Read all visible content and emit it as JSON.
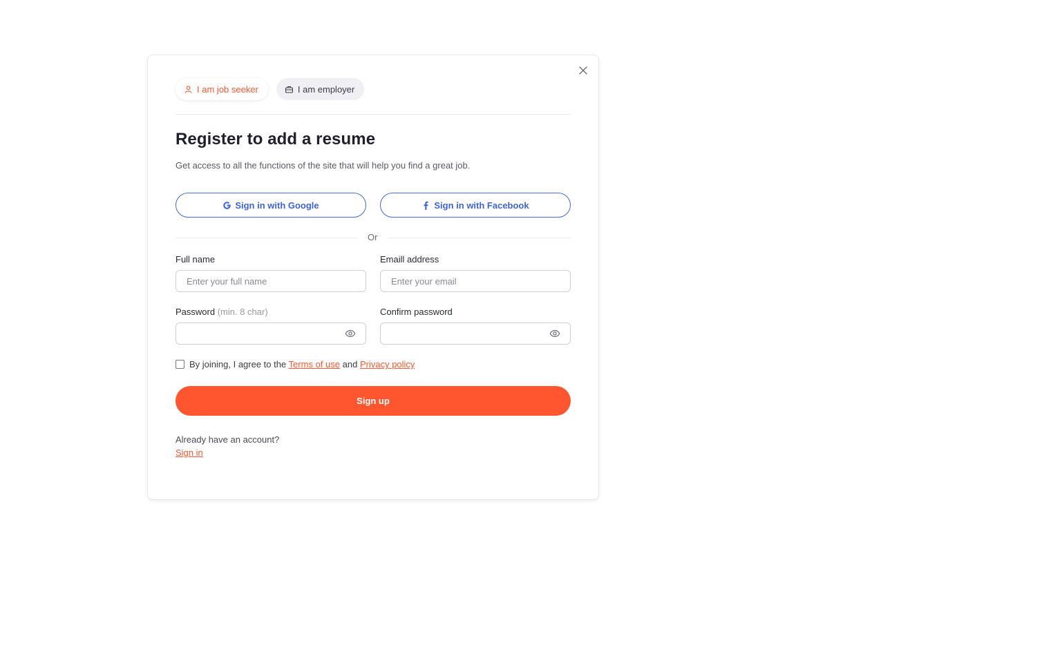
{
  "modal": {
    "role_tabs": [
      {
        "label": "I am job seeker",
        "icon": "person-icon",
        "active": true
      },
      {
        "label": "I am employer",
        "icon": "briefcase-icon",
        "active": false
      }
    ],
    "title": "Register to add a resume",
    "subtitle": "Get access to all the functions of the site that will help you find a great job.",
    "social": {
      "google_label": "Sign in with Google",
      "facebook_label": "Sign in with Facebook"
    },
    "or_text": "Or",
    "form": {
      "full_name": {
        "label": "Full name",
        "placeholder": "Enter your full name",
        "value": ""
      },
      "email": {
        "label": "Emaill address",
        "placeholder": "Enter your email",
        "value": ""
      },
      "password": {
        "label": "Password",
        "hint": "(min. 8 char)",
        "value": ""
      },
      "confirm_password": {
        "label": "Confirm password",
        "value": ""
      }
    },
    "consent": {
      "prefix": "By joining, I agree to the",
      "terms_link": "Terms of use",
      "and": "and",
      "privacy_link": "Privacy policy",
      "checked": false
    },
    "signup_label": "Sign up",
    "account_prompt": "Already have an account?",
    "signin_link": "Sign in"
  },
  "colors": {
    "accent": "#ff5630",
    "social_blue": "#4169e1",
    "text_dark": "#1f1f2e"
  }
}
